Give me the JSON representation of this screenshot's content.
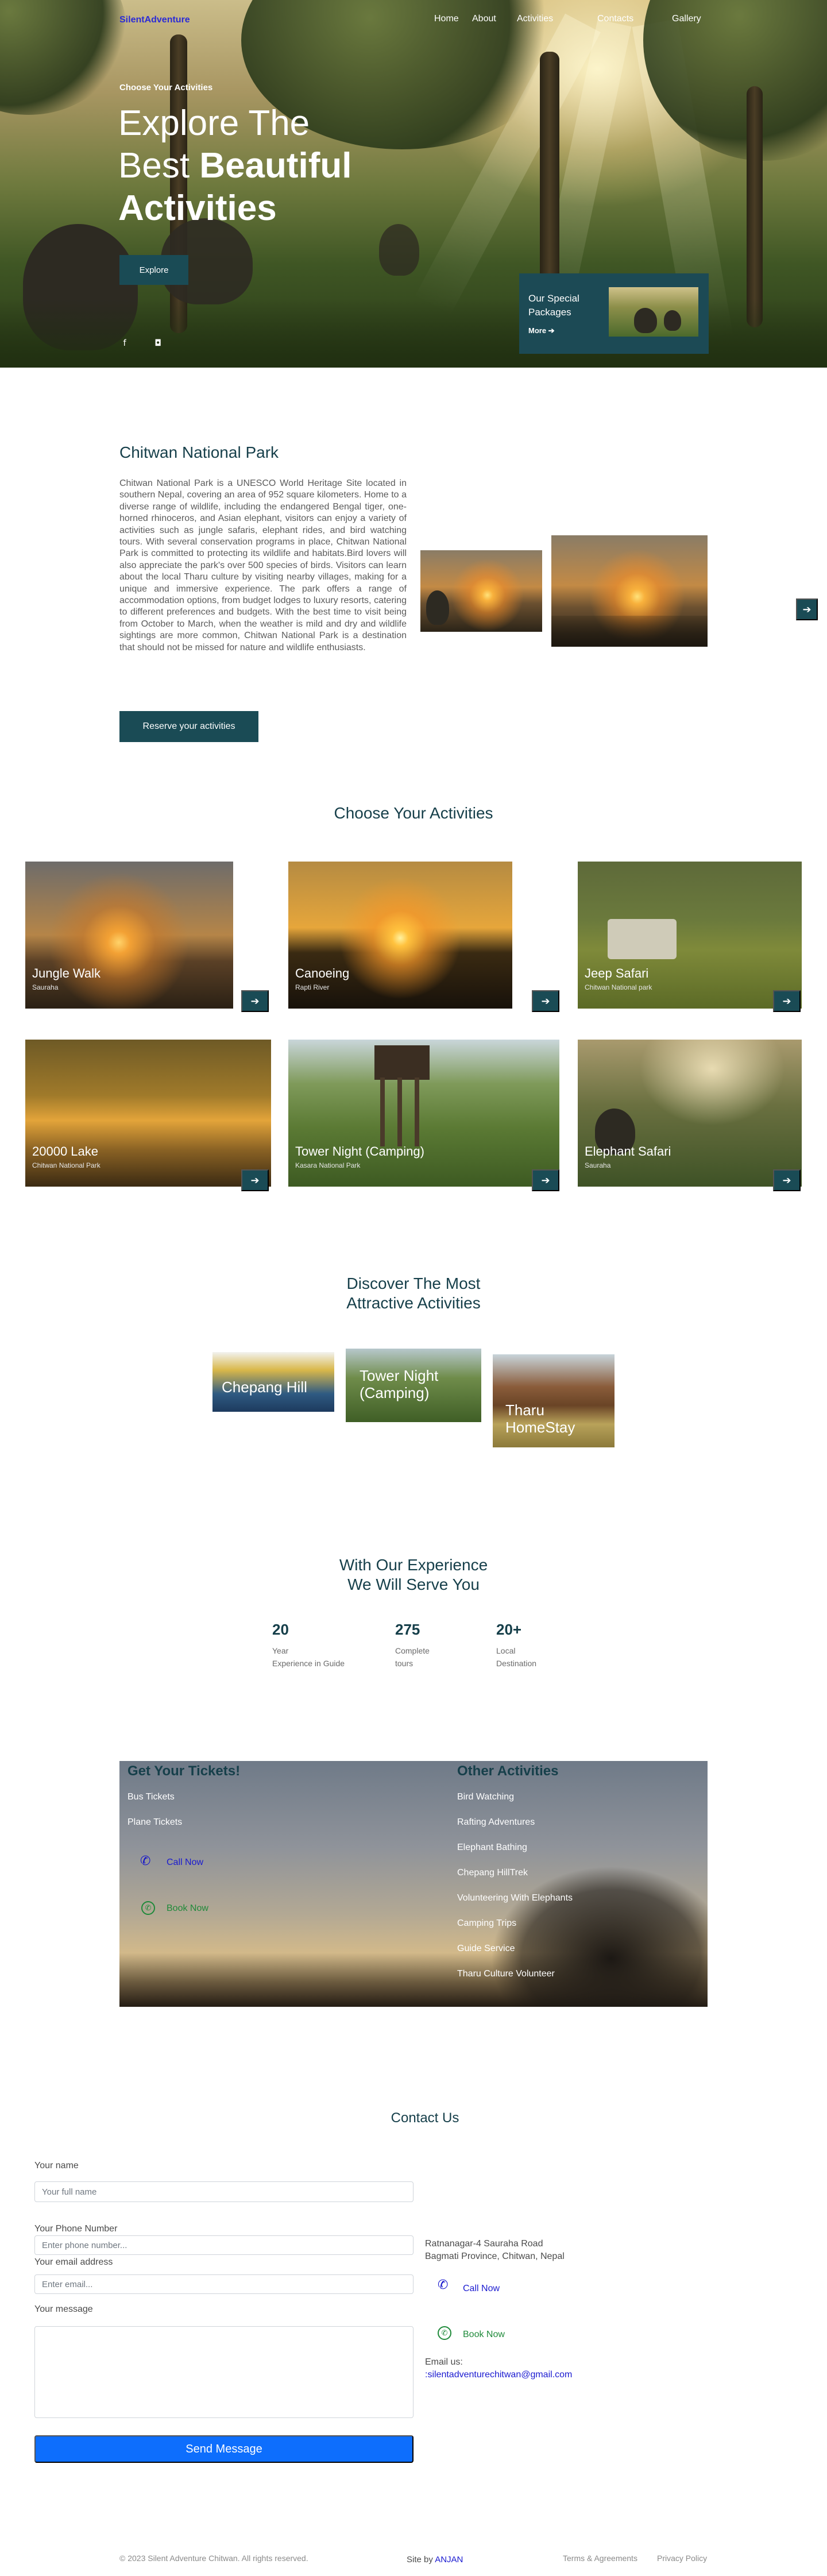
{
  "nav": {
    "brand": "SilentAdventure",
    "links": [
      "Home",
      "About",
      "Activities",
      "Contacts",
      "Gallery"
    ]
  },
  "hero": {
    "kicker": "Choose Your Activities",
    "title_line1": "Explore The",
    "title_line2_light": "Best ",
    "title_line2_bold": "Beautiful",
    "title_line3_bold": "Activities",
    "cta": "Explore",
    "special_title": "Our Special Packages",
    "special_more": "More ➔",
    "social_icons": [
      "facebook-icon",
      "instagram-icon"
    ]
  },
  "about": {
    "title": "Chitwan National Park",
    "body": "Chitwan National Park is a UNESCO World Heritage Site located in southern Nepal, covering an area of 952 square kilometers. Home to a diverse range of wildlife, including the endangered Bengal tiger, one-horned rhinoceros, and Asian elephant, visitors can enjoy a variety of activities such as jungle safaris, elephant rides, and bird watching tours. With several conservation programs in place, Chitwan National Park is committed to protecting its wildlife and habitats.Bird lovers will also appreciate the park's over 500 species of birds. Visitors can learn about the local Tharu culture by visiting nearby villages, making for a unique and immersive experience. The park offers a range of accommodation options, from budget lodges to luxury resorts, catering to different preferences and budgets. With the best time to visit being from October to March, when the weather is mild and dry and wildlife sightings are more common, Chitwan National Park is a destination that should not be missed for nature and wildlife enthusiasts.",
    "cta": "Reserve your activities"
  },
  "activities": {
    "title": "Choose Your Activities",
    "cards": [
      {
        "name": "Jungle Walk",
        "sub": "Sauraha"
      },
      {
        "name": "Canoeing",
        "sub": "Rapti River"
      },
      {
        "name": "Jeep Safari",
        "sub": "Chitwan National park"
      },
      {
        "name": "20000 Lake",
        "sub": "Chitwan National Park"
      },
      {
        "name": "Tower Night (Camping)",
        "sub": "Kasara National Park"
      },
      {
        "name": "Elephant Safari",
        "sub": "Sauraha"
      }
    ]
  },
  "discover": {
    "title_line1": "Discover The Most",
    "title_line2": "Attractive Activities",
    "cards": [
      "Chepang Hill",
      "Tower Night (Camping)",
      "Tharu HomeStay"
    ]
  },
  "experience": {
    "title_line1": "With Our Experience",
    "title_line2": "We Will Serve You",
    "stats": [
      {
        "num": "20",
        "l1": "Year",
        "l2": "Experience in Guide"
      },
      {
        "num": "275",
        "l1": "Complete",
        "l2": "tours"
      },
      {
        "num": "20+",
        "l1": "Local",
        "l2": "Destination"
      }
    ]
  },
  "tickets": {
    "left_title": "Get Your Tickets!",
    "left_items": [
      "Bus Tickets",
      "Plane Tickets"
    ],
    "call_now": "Call Now",
    "book_now": "Book Now",
    "right_title": "Other Activities",
    "right_items": [
      "Bird Watching",
      "Rafting Adventures",
      "Elephant Bathing",
      "Chepang HillTrek",
      "Volunteering With Elephants",
      "Camping Trips",
      "Guide Service",
      "Tharu Culture Volunteer"
    ]
  },
  "contact": {
    "title": "Contact Us",
    "name_label": "Your name",
    "name_placeholder": "Your full name",
    "phone_label": "Your Phone Number",
    "phone_placeholder": "Enter phone number...",
    "email_label": "Your email address",
    "email_placeholder": "Enter email...",
    "message_label": "Your message",
    "send": "Send Message",
    "address_line1": "Ratnanagar-4 Sauraha Road",
    "address_line2": "Bagmati Province, Chitwan, Nepal",
    "call_now": "Call Now",
    "book_now": "Book Now",
    "email_us": "Email us:",
    "email": ":silentadventurechitwan@gmail.com"
  },
  "footer": {
    "copyright": "© 2023 Silent Adventure Chitwan. All rights reserved.",
    "site_by": "Site by ",
    "author": "ANJAN",
    "terms": "Terms & Agreements",
    "privacy": "Privacy Policy"
  },
  "colors": {
    "teal": "#1a4b55",
    "heading": "#163f4a",
    "brand": "#2b2bd6",
    "send": "#0d6efd",
    "whatsapp": "#1f8a3a"
  }
}
